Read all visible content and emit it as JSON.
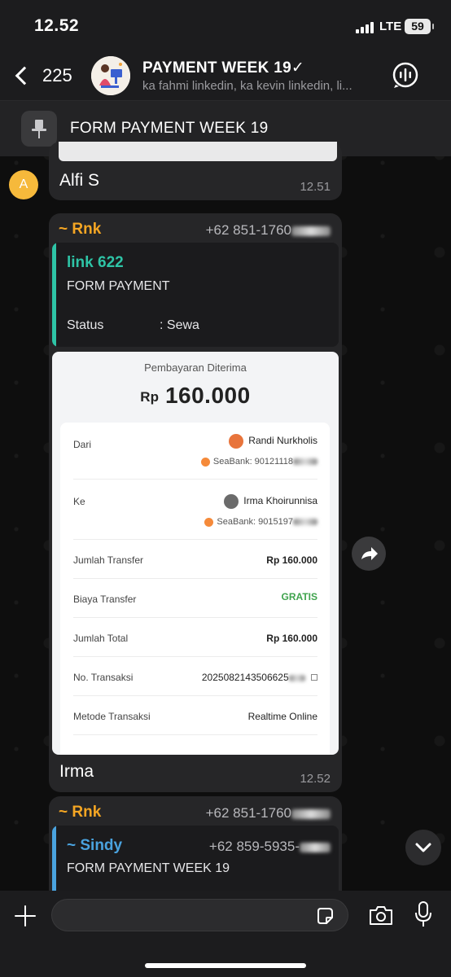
{
  "status": {
    "time": "12.52",
    "network": "LTE",
    "battery": "59"
  },
  "header": {
    "back_count": "225",
    "title": "PAYMENT WEEK 19✓",
    "subtitle": "ka fahmi linkedin, ka kevin linkedin, li..."
  },
  "pinned": {
    "text": "FORM PAYMENT WEEK 19"
  },
  "messages": {
    "alfi": {
      "avatar_letter": "A",
      "text": "Alfi S",
      "time": "12.51"
    },
    "m1": {
      "sender": "~ Rnk",
      "phone": "+62 851-1760",
      "quote": {
        "title": "link 622",
        "line1": "FORM PAYMENT",
        "status_label": "Status",
        "status_value": ": Sewa"
      },
      "receipt": {
        "title": "Pembayaran Diterima",
        "currency": "Rp",
        "amount": "160.000",
        "dari_label": "Dari",
        "dari_name": "Randi Nurkholis",
        "dari_bank": "SeaBank: 90121118",
        "ke_label": "Ke",
        "ke_name": "Irma Khoirunnisa",
        "ke_bank": "SeaBank: 9015197",
        "jumlah_transfer_label": "Jumlah Transfer",
        "jumlah_transfer_value": "Rp 160.000",
        "biaya_label": "Biaya Transfer",
        "biaya_value": "GRATIS",
        "total_label": "Jumlah Total",
        "total_value": "Rp 160.000",
        "notrans_label": "No. Transaksi",
        "notrans_value": "2025082143506625",
        "metode_label": "Metode Transaksi",
        "metode_value": "Realtime Online"
      },
      "caption": "Irma",
      "time": "12.52"
    },
    "m2": {
      "sender": "~ Rnk",
      "phone": "+62 851-1760",
      "quote": {
        "sender": "~ Sindy",
        "phone": "+62 859-5935-",
        "text": "FORM PAYMENT WEEK 19"
      }
    }
  },
  "colors": {
    "sender": "#f5a623",
    "link": "#2ec4a6",
    "quote_blue": "#4aa3df",
    "gratis": "#3fa34d"
  }
}
